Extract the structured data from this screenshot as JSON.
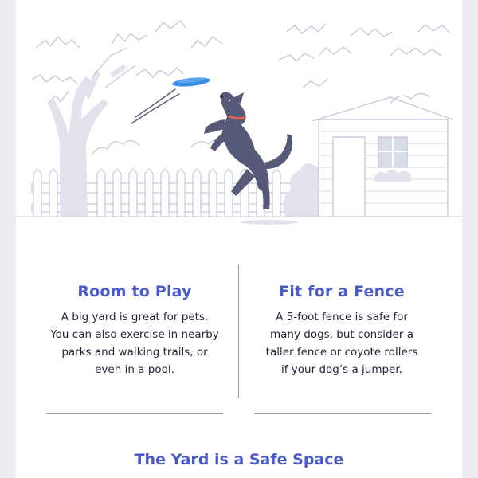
{
  "illustration": {
    "description_icon": "dog-catching-frisbee-illustration"
  },
  "columns": [
    {
      "title": "Room to Play",
      "lines": [
        "A big yard is great for pets.",
        "You can also exercise in nearby",
        "parks and walking trails, or",
        "even in a pool."
      ]
    },
    {
      "title": "Fit for a Fence",
      "lines": [
        "A 5-foot fence is safe for",
        "many dogs, but consider a",
        "taller fence or coyote rollers",
        "if your dog’s a jumper."
      ]
    }
  ],
  "section": {
    "title": "The Yard is a Safe Space"
  },
  "colors": {
    "accent": "#4a5ac9",
    "frisbee": "#3b8ee8",
    "dog": "#565a78",
    "collar": "#e0605a",
    "line_art": "#c7c9da"
  }
}
